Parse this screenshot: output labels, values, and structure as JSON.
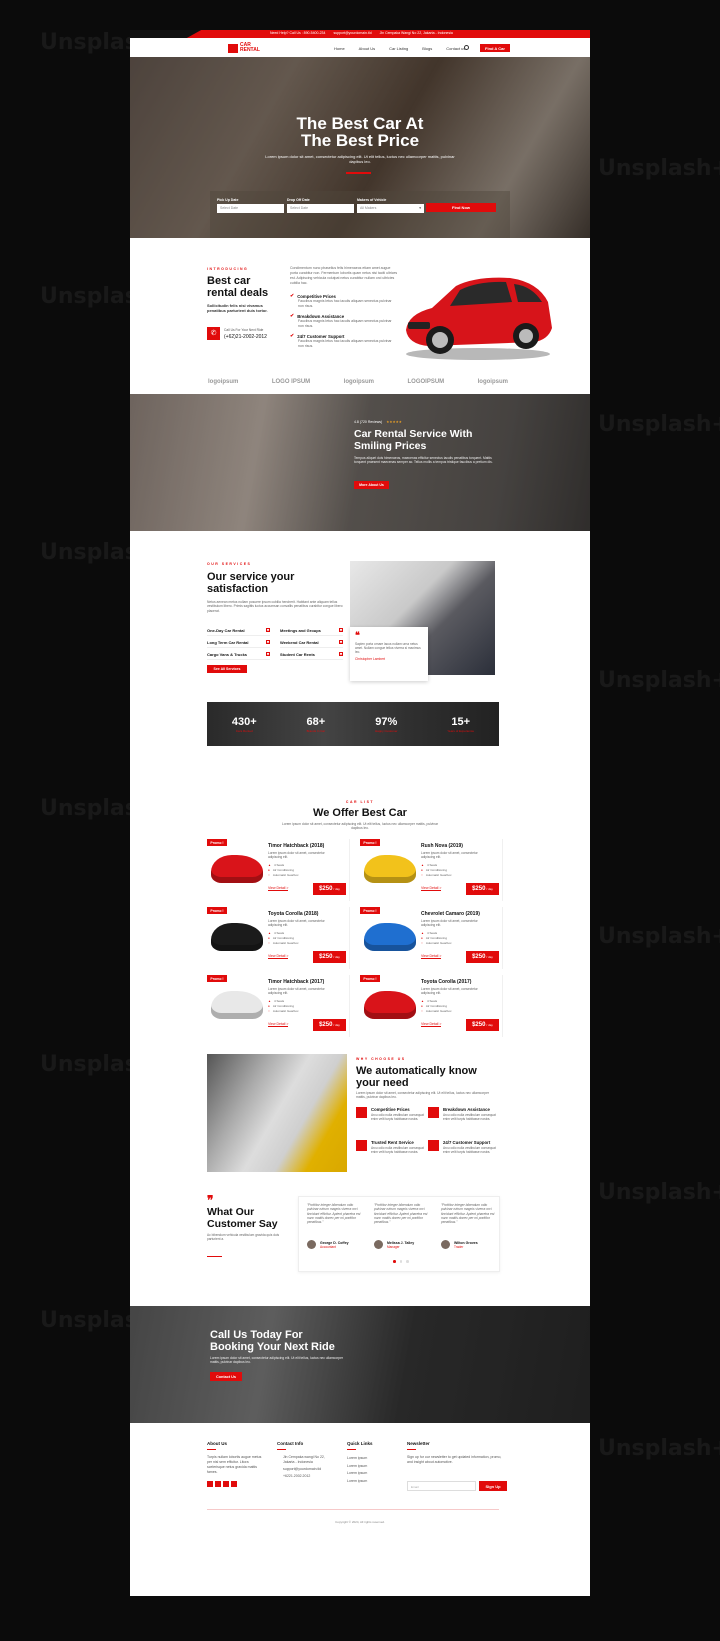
{
  "watermark": "Unsplash+",
  "topbar": {
    "social_icons": [
      "facebook-icon",
      "twitter-icon",
      "youtube-icon",
      "instagram-icon"
    ],
    "need_help": "Need Help?  Call Us : 890-5400-234",
    "email": "support@yourdomain.tld",
    "address": "Jln Cempaka Wangi No 22, Jakarta - Indonesia"
  },
  "nav": {
    "logo_line1": "CAR",
    "logo_line2": "RENTAL",
    "menu": [
      "Home",
      "About Us",
      "Car Listing",
      "Blogs",
      "Contact us"
    ],
    "cta": "Find A Car"
  },
  "hero": {
    "title_line1": "The Best Car At",
    "title_line2": "The Best Price",
    "subtitle": "Lorem ipsum dolor sit amet, consectetur adipiscing elit. Ut elit tellus, luctus nec ullamcorper mattis, pulvinar dapibus leo.",
    "booking": {
      "pickup_label": "Pick Up Date",
      "pickup_placeholder": "Select Date",
      "dropoff_label": "Drop Off Date",
      "dropoff_placeholder": "Select Date",
      "makers_label": "Makers of Vehicle",
      "makers_value": "All Makers",
      "submit": "Find Now"
    }
  },
  "deals": {
    "eyebrow": "INTRODUCING",
    "title_line1": "Best car",
    "title_line2": "rental deals",
    "lead": "Sollicitudin felis nisi vivamus penatibus parturient duis tortor.",
    "call_label": "Call Us For Your Next Ride",
    "phone": "(+62)21-2002-2012",
    "intro": "Condimentum nunc phasellus felis himenaeos etiam amet augue porta curabitur non. Fermentum lobortis quam netus nisi taciti ultrices est. Adipiscing vehicula volutpat netus curabitur nullam orci ultricies cubilia hac.",
    "features": [
      {
        "title": "Competitive Prices",
        "text": "Faucibus magnis letus hac iaculis aliquam senectus pulvinar non risus."
      },
      {
        "title": "Breakdown Assistance",
        "text": "Faucibus magnis letus hac iaculis aliquam senectus pulvinar non risus."
      },
      {
        "title": "24/7 Customer Support",
        "text": "Faucibus magnis letus hac iaculis aliquam senectus pulvinar non risus."
      }
    ],
    "partner_logos": [
      "logoipsum",
      "LOGO IPSUM",
      "logoipsum",
      "LOGOIPSUM",
      "logoipsum"
    ]
  },
  "about_banner": {
    "rating": "4.8 (720 Reviews)",
    "stars": "★★★★★",
    "title_line1": "Car Rental Service With",
    "title_line2": "Smiling Prices",
    "text": "Tempus aliquet duis himenaeos, maecenas efficitur senectus iaculis penatibus torquent. Mattis torquent praesent maecenas semper ac. Tellus mollis a tempus tristique faucibus a pretium dis.",
    "button": "More About Us"
  },
  "services": {
    "eyebrow": "OUR SERVICES",
    "title_line1": "Our service your",
    "title_line2": "satisfaction",
    "text": "Netus aenean metus nullam posuere ipsum cubilia hendrerit. Habitant ante aliquam tellus vestibulum libero. Primis sagittis luctus accumsan convallis penatibus curabitur congue libero placerat.",
    "items": [
      "One-Day Car Rental",
      "Meetings and Groups",
      "Long Term Car Rental",
      "Weekend Car Rental",
      "Cargo Vans & Trucks",
      "Student Car Rents"
    ],
    "button": "See All Services",
    "quote": "Sapien porta ornare lacus nullam urna netus amet. Nullam congue tellus viverra si maximus leo.",
    "quote_author": "Christopher Lambert"
  },
  "stats": [
    {
      "value": "430+",
      "label": "Cars Rented"
    },
    {
      "value": "68+",
      "label": "Brands In Car"
    },
    {
      "value": "97%",
      "label": "Happy Customer"
    },
    {
      "value": "15+",
      "label": "Years of Experience"
    }
  ],
  "car_list": {
    "eyebrow": "CAR LIST",
    "title": "We Offer Best Car",
    "subtitle": "Lorem ipsum dolor sit amet, consectetur adipiscing elit. Ut elit tellus, luctus nec ullamcorper mattis, pulvinar dapibus leo.",
    "badge": "Promo !",
    "desc": "Lorem ipsum dolor sit amet, consectetur adipiscing elit.",
    "features": [
      "4 Seats",
      "Air Conditioning",
      "Automatic Gearbox"
    ],
    "view": "View Detail >",
    "per": "/ day",
    "cars": [
      {
        "name": "Timor Hatchback (2018)",
        "price": "$250",
        "color": "#d9141a"
      },
      {
        "name": "Rush Nova (2019)",
        "price": "$250",
        "color": "#f2c21b"
      },
      {
        "name": "Toyota Corolla (2018)",
        "price": "$250",
        "color": "#1b1b1b"
      },
      {
        "name": "Chevrolet Camaro (2019)",
        "price": "$250",
        "color": "#1f6fd0"
      },
      {
        "name": "Timor Hatchback (2017)",
        "price": "$250",
        "color": "#e8e8e8"
      },
      {
        "name": "Toyota Corolla (2017)",
        "price": "$250",
        "color": "#d9141a"
      }
    ]
  },
  "why": {
    "eyebrow": "WHY CHOOSE US",
    "title_line1": "We automatically know",
    "title_line2": "your need",
    "text": "Lorem ipsum dolor sit amet, consectetur adipiscing elit. Ut elit tellus, luctus nec ullamcorper mattis, pulvinar dapibus leo.",
    "features": [
      {
        "title": "Competitive Prices",
        "text": "Arcu odio nulla vestibulum consequat enim velit turpis habitasse nostra."
      },
      {
        "title": "Breakdown Assistance",
        "text": "Arcu odio nulla vestibulum consequat enim velit turpis habitasse nostra."
      },
      {
        "title": "Trusted Rent Service",
        "text": "Arcu odio nulla vestibulum consequat enim velit turpis habitasse nostra."
      },
      {
        "title": "24/7 Customer Support",
        "text": "Arcu odio nulla vestibulum consequat enim velit turpis habitasse nostra."
      }
    ]
  },
  "testimonials": {
    "title_line1": "What Our",
    "title_line2": "Customer Say",
    "text": "Ac bibendum vehicula vestibulum gravida quis duis parturient a.",
    "items": [
      {
        "quote": "\"Porttitor integer bibendum odio pulvinar rutrum magnis viverra orci tincidunt efficitur. Aptent pharetra est nunc mattis donec per mi porttitor penatibus.\"",
        "name": "George D. Coffey",
        "role": "Accountant"
      },
      {
        "quote": "\"Porttitor integer bibendum odio pulvinar rutrum magnis viverra orci tincidunt efficitur. Aptent pharetra est nunc mattis donec per mi porttitor penatibus.\"",
        "name": "Melissa J. Talley",
        "role": "Manager"
      },
      {
        "quote": "\"Porttitor integer bibendum odio pulvinar rutrum magnis viverra orci tincidunt efficitur. Aptent pharetra est nunc mattis donec per mi porttitor penatibus.\"",
        "name": "Wilton Groves",
        "role": "Trader"
      }
    ]
  },
  "cta": {
    "title_line1": "Call Us Today For",
    "title_line2": "Booking Your Next Ride",
    "text": "Lorem ipsum dolor sit amet, consectetur adipiscing elit. Ut elit tellus, luctus nec ullamcorper mattis, pulvinar dapibus leo.",
    "button": "Contact Us"
  },
  "footer": {
    "about_title": "About Us",
    "about_text": "Turpis nullam lobortis augue metus per nisl sem efficitur. Litora scelerisque netus gravida mattis fames.",
    "contact_title": "Contact Info",
    "contact_address": "Jln Cempaka wangi No 22, Jakarta - Indonesia",
    "contact_email": "support@yourdomain.tld",
    "contact_phone": "+6221.2002.2012",
    "links_title": "Quick Links",
    "links": [
      "Lorem ipsum",
      "Lorem ipsum",
      "Lorem ipsum",
      "Lorem ipsum"
    ],
    "newsletter_title": "Newsletter",
    "newsletter_text": "Sign up for our newsletter to get updated information, promo, and insight about automotive.",
    "email_placeholder": "Email",
    "signup": "Sign Up",
    "copyright": "Copyright © 2024, All rights reserved."
  },
  "colors": {
    "accent": "#e10b0b",
    "dark": "#111111"
  }
}
